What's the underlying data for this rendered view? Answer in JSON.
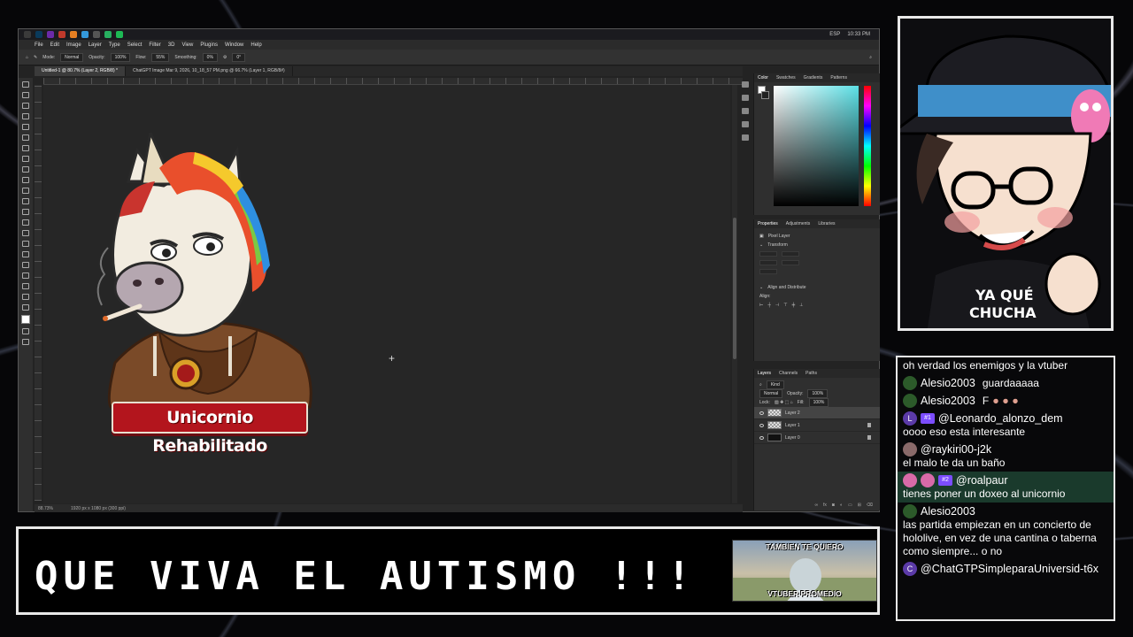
{
  "taskbar": {
    "lang": "ESP",
    "clock": "10:33 PM"
  },
  "photoshop": {
    "menu": [
      "File",
      "Edit",
      "Image",
      "Layer",
      "Type",
      "Select",
      "Filter",
      "3D",
      "View",
      "Plugins",
      "Window",
      "Help"
    ],
    "options": {
      "mode_label": "Mode:",
      "mode_value": "Normal",
      "opacity_label": "Opacity:",
      "opacity_value": "100%",
      "flow_label": "Flow:",
      "flow_value": "55%",
      "smoothing_label": "Smoothing:",
      "smoothing_value": "0%",
      "angle_value": "0°"
    },
    "tabs": [
      {
        "label": "Untitled-1 @ 80.7% (Layer 2, RGB/8) *"
      },
      {
        "label": "ChatGPT Image Mar 9, 2026, 10_18_57 PM.png @ 66.7% (Layer 1, RGB/8#)"
      }
    ],
    "status": {
      "zoom": "88.73%",
      "doc": "1920 px x 1080 px (300 ppi)"
    },
    "color_panel_tabs": [
      "Color",
      "Swatches",
      "Gradients",
      "Patterns"
    ],
    "props_panel_tabs": [
      "Properties",
      "Adjustments",
      "Libraries"
    ],
    "props": {
      "kind": "Pixel Layer",
      "transform": "Transform",
      "align": "Align and Distribute",
      "align_sub": "Align:"
    },
    "layers_panel_tabs": [
      "Layers",
      "Channels",
      "Paths"
    ],
    "layers_controls": {
      "kind": "Kind",
      "blend": "Normal",
      "opacity_label": "Opacity:",
      "opacity": "100%",
      "lock_label": "Lock:",
      "fill_label": "Fill:",
      "fill": "100%"
    },
    "layers": [
      {
        "name": "Layer 2",
        "selected": true
      },
      {
        "name": "Layer 1",
        "selected": false
      },
      {
        "name": "Layer 0",
        "selected": false
      }
    ]
  },
  "artwork": {
    "banner_text": "Unicornio Rehabilitado"
  },
  "avatar": {
    "shirt_text_1": "YA QUÉ",
    "shirt_text_2": "CHUCHA"
  },
  "chat": {
    "messages": [
      {
        "user": "",
        "text": "oh verdad los enemigos y la vtuber"
      },
      {
        "user": "Alesio2003",
        "text": "guardaaaaa"
      },
      {
        "user": "Alesio2003",
        "text": "F"
      },
      {
        "user": "@Leonardo_alonzo_dem",
        "badge": "#1",
        "avatar": "L",
        "text": "oooo eso esta interesante"
      },
      {
        "user": "@raykiri00-j2k",
        "text": "el malo te da un baño"
      },
      {
        "user": "@roalpaur",
        "badge": "#2",
        "text": "tienes poner un doxeo al unicornio"
      },
      {
        "user": "Alesio2003",
        "text": "las partida empiezan en un concierto de hololive, en vez de una cantina o taberna como siempre... o no"
      },
      {
        "user": "@ChatGTPSimpleparaUniversid-t6x",
        "avatar": "C",
        "text": ""
      }
    ]
  },
  "ticker": {
    "text": "QUE VIVA EL AUTISMO !!!"
  },
  "meme": {
    "top": "TAMBIEN TE QUIERO",
    "bottom": "VTUBER PROMEDIO"
  },
  "colors": {
    "accent": "#31a8ff",
    "banner_red": "#b3151d",
    "chat_highlight": "#1a3a2c"
  }
}
